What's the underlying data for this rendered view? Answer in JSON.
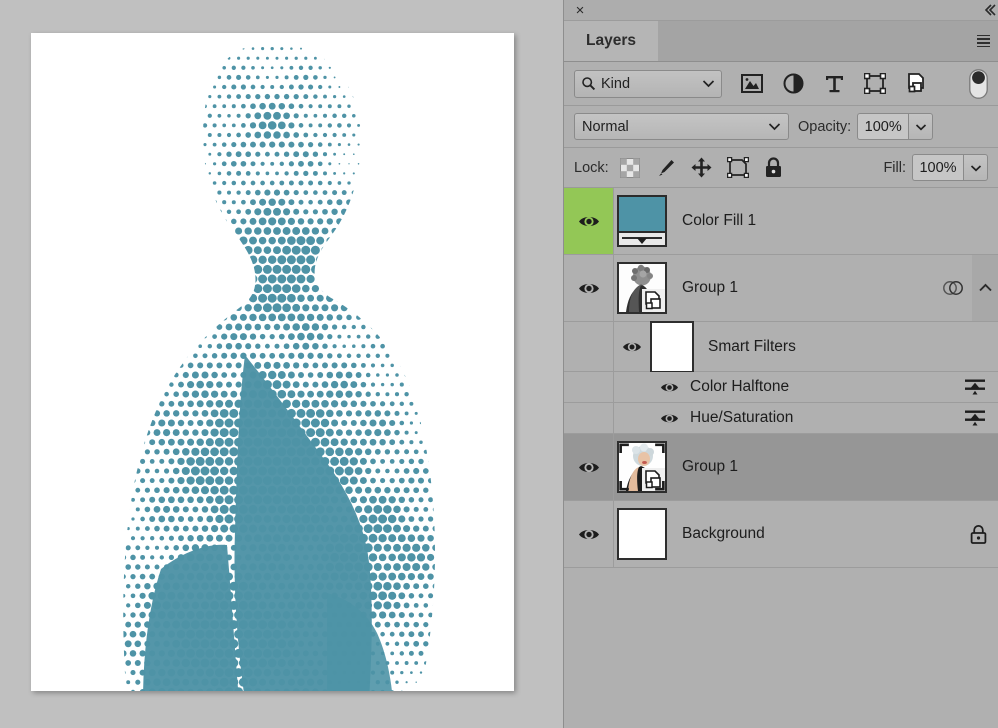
{
  "panel": {
    "close_label": "×",
    "collapse_icon": "double-chevron-right",
    "menu_icon": "hamburger-menu"
  },
  "tabs": [
    {
      "label": "Layers",
      "active": true
    }
  ],
  "filter_row": {
    "kind_label": "Kind",
    "search_icon": "search-icon",
    "chevron_icon": "chevron-down-icon",
    "icons": [
      {
        "name": "filter-pixel-layers-icon",
        "title": "Pixel layers"
      },
      {
        "name": "filter-adjustment-layers-icon",
        "title": "Adjustment layers"
      },
      {
        "name": "filter-type-layers-icon",
        "title": "Type layers"
      },
      {
        "name": "filter-shape-layers-icon",
        "title": "Shape layers"
      },
      {
        "name": "filter-smart-objects-icon",
        "title": "Smart objects"
      }
    ],
    "toggle_name": "filter-enable-toggle"
  },
  "blend_row": {
    "blend_mode": "Normal",
    "opacity_label": "Opacity:",
    "opacity_value": "100%"
  },
  "lock_row": {
    "lock_label": "Lock:",
    "fill_label": "Fill:",
    "fill_value": "100%",
    "icons": [
      {
        "name": "lock-transparent-pixels-icon"
      },
      {
        "name": "lock-image-pixels-icon"
      },
      {
        "name": "lock-position-icon"
      },
      {
        "name": "lock-artboard-nesting-icon"
      },
      {
        "name": "lock-all-icon"
      }
    ]
  },
  "layers": [
    {
      "name": "Color Fill 1",
      "type": "fill-layer",
      "visible": true,
      "eye_highlight_color": "#93c756",
      "thumbnail": "color-fill-teal-swatch",
      "fill_color": "#4e93a6",
      "selected": false
    },
    {
      "name": "Group 1",
      "type": "smart-object-group",
      "visible": true,
      "thumbnail": "grayscale-portrait-smart-object",
      "clipped": true,
      "collapse_state": "expanded",
      "selected": false
    },
    {
      "name": "Smart Filters",
      "type": "smart-filters-header",
      "visible": true,
      "thumbnail": "white-mask",
      "selected": false
    },
    {
      "name": "Color Halftone",
      "type": "smart-filter",
      "visible": true,
      "settings_icon": "filter-settings-icon",
      "selected": false
    },
    {
      "name": "Hue/Saturation",
      "type": "smart-filter",
      "visible": true,
      "settings_icon": "filter-settings-icon",
      "selected": false
    },
    {
      "name": "Group 1",
      "type": "smart-object-group",
      "visible": true,
      "thumbnail": "color-portrait-smart-object",
      "selected": true
    },
    {
      "name": "Background",
      "type": "background-layer",
      "visible": true,
      "thumbnail": "white-fill",
      "locked": true,
      "selected": false
    }
  ],
  "canvas": {
    "document_name": "halftone-portrait",
    "artwork_description": "Teal halftone dot-pattern silhouette portrait of a woman on white background",
    "halftone_color": "#4e93a6",
    "background_color": "#ffffff"
  }
}
